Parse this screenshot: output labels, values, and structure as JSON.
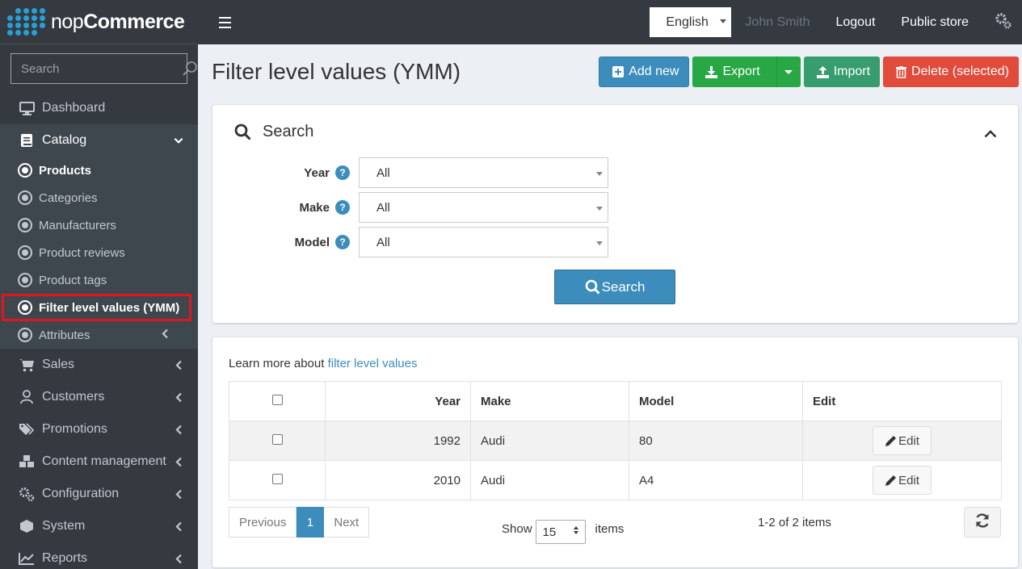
{
  "brand": {
    "name_light": "nop",
    "name_bold": "Commerce"
  },
  "sidebar": {
    "search_placeholder": "Search",
    "items": [
      {
        "label": "Dashboard",
        "icon": "monitor-icon"
      },
      {
        "label": "Catalog",
        "icon": "book-icon"
      },
      {
        "label": "Sales",
        "icon": "cart-icon"
      },
      {
        "label": "Customers",
        "icon": "user-icon"
      },
      {
        "label": "Promotions",
        "icon": "tags-icon"
      },
      {
        "label": "Content management",
        "icon": "cubes-icon"
      },
      {
        "label": "Configuration",
        "icon": "gears-icon"
      },
      {
        "label": "System",
        "icon": "cube-icon"
      },
      {
        "label": "Reports",
        "icon": "line-chart-icon"
      }
    ],
    "catalog_sub": [
      {
        "label": "Products"
      },
      {
        "label": "Categories"
      },
      {
        "label": "Manufacturers"
      },
      {
        "label": "Product reviews"
      },
      {
        "label": "Product tags"
      },
      {
        "label": "Filter level values (YMM)"
      },
      {
        "label": "Attributes"
      }
    ]
  },
  "topbar": {
    "language": "English",
    "user": "John Smith",
    "logout": "Logout",
    "public_store": "Public store"
  },
  "page": {
    "title": "Filter level values (YMM)",
    "buttons": {
      "add_new": "Add new",
      "export": "Export",
      "import": "Import",
      "delete_selected": "Delete (selected)"
    }
  },
  "search": {
    "heading": "Search",
    "fields": [
      {
        "label": "Year",
        "value": "All"
      },
      {
        "label": "Make",
        "value": "All"
      },
      {
        "label": "Model",
        "value": "All"
      }
    ],
    "button": "Search"
  },
  "list": {
    "learn_text": "Learn more about",
    "learn_link": "filter level values",
    "columns": {
      "year": "Year",
      "make": "Make",
      "model": "Model",
      "edit": "Edit"
    },
    "rows": [
      {
        "year": "1992",
        "make": "Audi",
        "model": "80",
        "edit": "Edit"
      },
      {
        "year": "2010",
        "make": "Audi",
        "model": "A4",
        "edit": "Edit"
      }
    ],
    "pager": {
      "previous": "Previous",
      "current": "1",
      "next": "Next"
    },
    "show_label": "Show",
    "page_size": "15",
    "items_label": "items",
    "items_count": "1-2 of 2 items"
  },
  "colors": {
    "sidebar_bg": "#343a40",
    "primary": "#3c8dbc",
    "success": "#28a745",
    "danger": "#e04b3c",
    "highlight_outline": "#e0161f"
  }
}
